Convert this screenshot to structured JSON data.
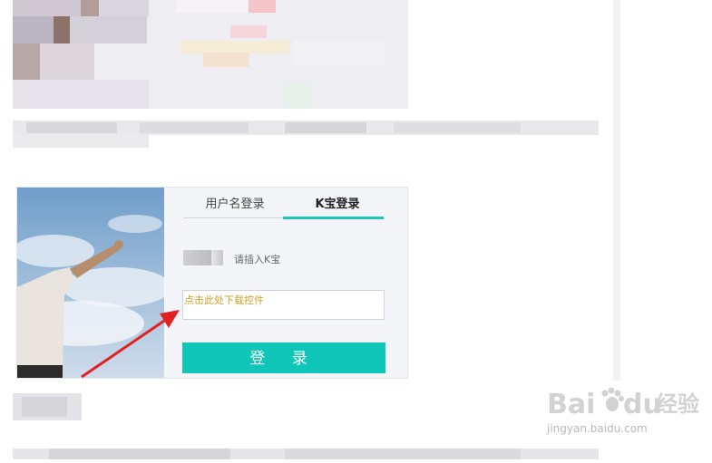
{
  "login": {
    "tabs": [
      {
        "label": "用户名登录"
      },
      {
        "label": "K宝登录"
      }
    ],
    "insert_hint": "请插入K宝",
    "download_link": "点击此处下载控件",
    "login_button": "登 录"
  },
  "watermark": {
    "brand": "Bai",
    "brand2": "du",
    "cn": "经验",
    "url": "jingyan.baidu.com"
  },
  "colors": {
    "accent": "#10c6b8",
    "link": "#c9a227",
    "arrow": "#e02222"
  }
}
